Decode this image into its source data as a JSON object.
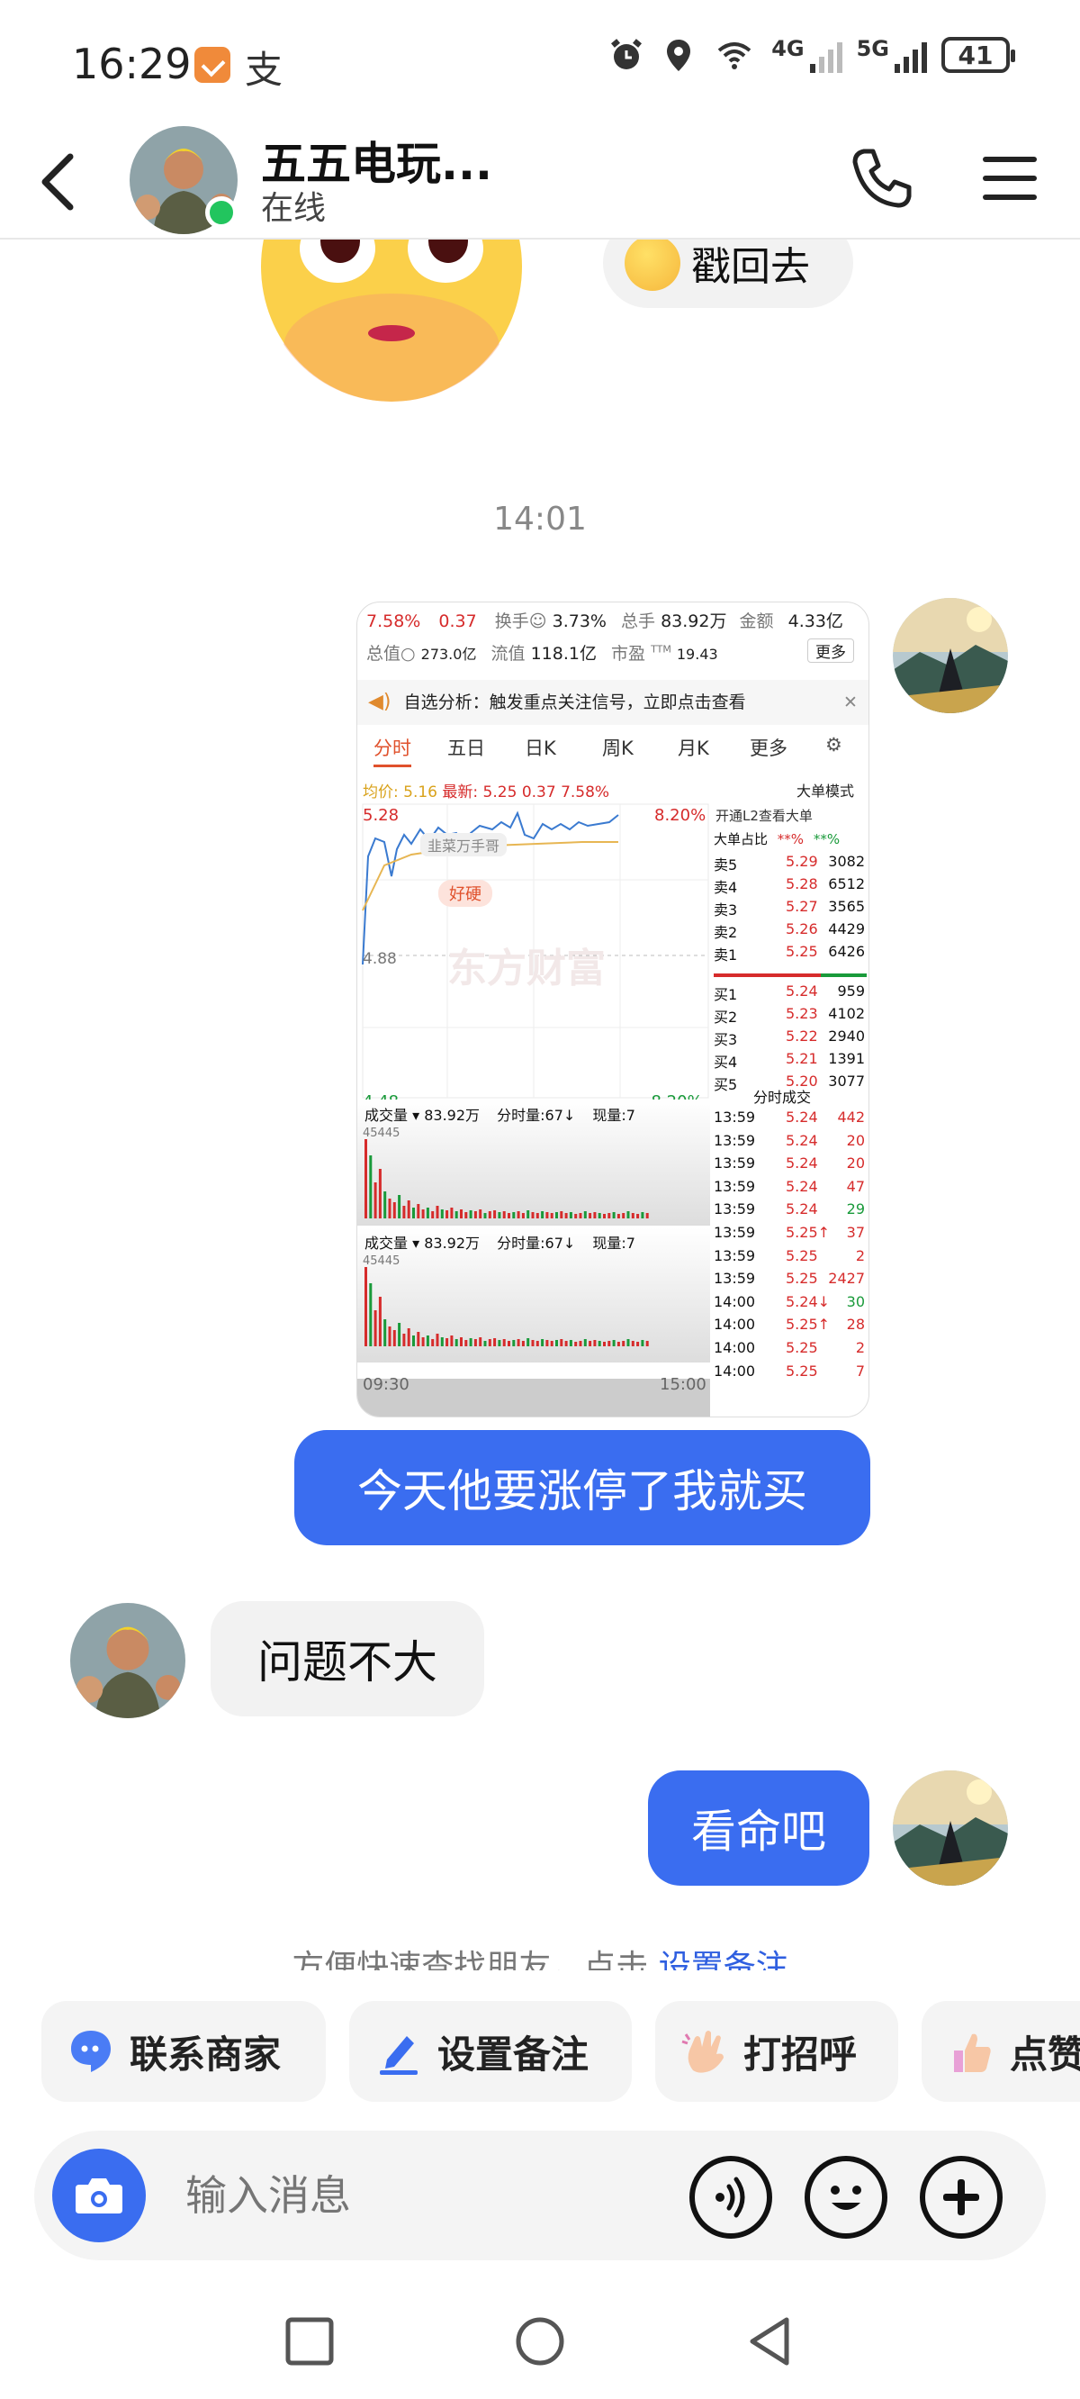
{
  "status_bar": {
    "time": "16:29",
    "app_icon_2": "支",
    "net_4g": "4G",
    "net_5g": "5G",
    "battery": "41"
  },
  "header": {
    "name": "五五电玩...",
    "status": "在线"
  },
  "messages": {
    "sticker_reply": "戳回去",
    "timestamp": "14:01",
    "me_1": "今天他要涨停了我就买",
    "other_1": "问题不大",
    "me_2": "看命吧"
  },
  "stock_screenshot": {
    "row1": {
      "pct": "7.58%",
      "chg": "0.37",
      "turnover_label": "换手☺",
      "turnover": "3.73%",
      "vol_label": "总手",
      "vol": "83.92万",
      "amt_label": "金额",
      "amt": "4.33亿"
    },
    "row2": {
      "mktcap_label": "总值○",
      "mktcap": "273.0亿",
      "float_label": "流值",
      "float": "118.1亿",
      "pe_label": "市盈",
      "pe_sup": "TTM",
      "pe": "19.43",
      "more": "更多"
    },
    "notice": "自选分析：触发重点关注信号，立即点击查看",
    "tabs": [
      "分时",
      "五日",
      "日K",
      "周K",
      "月K",
      "更多"
    ],
    "avg_label": "均价:",
    "avg": "5.16",
    "latest_label": "最新:",
    "latest": "5.25",
    "latest_chg": "0.37",
    "latest_pct": "7.58%",
    "big_order_mode": "大单模式",
    "high": "5.28",
    "high_pct": "8.20%",
    "mid": "4.88",
    "low": "4.48",
    "low_pct": "-8.20%",
    "watermark_user": "韭菜万手哥",
    "tag": "好硬",
    "brand_watermark": "东方财富",
    "l2_link": "开通L2查看大单",
    "big_ratio_label": "大单占比",
    "big_ratio_a": "**%",
    "big_ratio_b": "**%",
    "asks": [
      {
        "label": "卖5",
        "price": "5.29",
        "vol": "3082"
      },
      {
        "label": "卖4",
        "price": "5.28",
        "vol": "6512"
      },
      {
        "label": "卖3",
        "price": "5.27",
        "vol": "3565"
      },
      {
        "label": "卖2",
        "price": "5.26",
        "vol": "4429"
      },
      {
        "label": "卖1",
        "price": "5.25",
        "vol": "6426"
      }
    ],
    "bids": [
      {
        "label": "买1",
        "price": "5.24",
        "vol": "959"
      },
      {
        "label": "买2",
        "price": "5.23",
        "vol": "4102"
      },
      {
        "label": "买3",
        "price": "5.22",
        "vol": "2940"
      },
      {
        "label": "买4",
        "price": "5.21",
        "vol": "1391"
      },
      {
        "label": "买5",
        "price": "5.20",
        "vol": "3077"
      }
    ],
    "ticks_label": "分时成交",
    "ticks": [
      {
        "t": "13:59",
        "p": "5.24",
        "v": "442"
      },
      {
        "t": "13:59",
        "p": "5.24",
        "v": "20"
      },
      {
        "t": "13:59",
        "p": "5.24",
        "v": "20"
      },
      {
        "t": "13:59",
        "p": "5.24",
        "v": "47"
      },
      {
        "t": "13:59",
        "p": "5.24",
        "v": "29"
      },
      {
        "t": "13:59",
        "p": "5.25↑",
        "v": "37"
      },
      {
        "t": "13:59",
        "p": "5.25",
        "v": "2"
      },
      {
        "t": "13:59",
        "p": "5.25",
        "v": "2427"
      },
      {
        "t": "14:00",
        "p": "5.24↓",
        "v": "30"
      },
      {
        "t": "14:00",
        "p": "5.25↑",
        "v": "28"
      },
      {
        "t": "14:00",
        "p": "5.25",
        "v": "2"
      },
      {
        "t": "14:00",
        "p": "5.25",
        "v": "7"
      }
    ],
    "vol_panel_label": "成交量",
    "vol_panel_total": "83.92万",
    "vol_panel_minute": "分时量:67↓",
    "vol_panel_now": "现量:7",
    "vol_axis": "45445",
    "time_start": "09:30",
    "time_end": "15:00"
  },
  "tip": {
    "text": "方便快速查找朋友，点击",
    "link": "设置备注"
  },
  "quick_actions": [
    "联系商家",
    "设置备注",
    "打招呼",
    "点赞"
  ],
  "input": {
    "placeholder": "输入消息"
  },
  "colors": {
    "accent": "#3a6df0",
    "online": "#22c55e",
    "stock_up": "#d62b2b",
    "stock_down": "#199a3a"
  }
}
